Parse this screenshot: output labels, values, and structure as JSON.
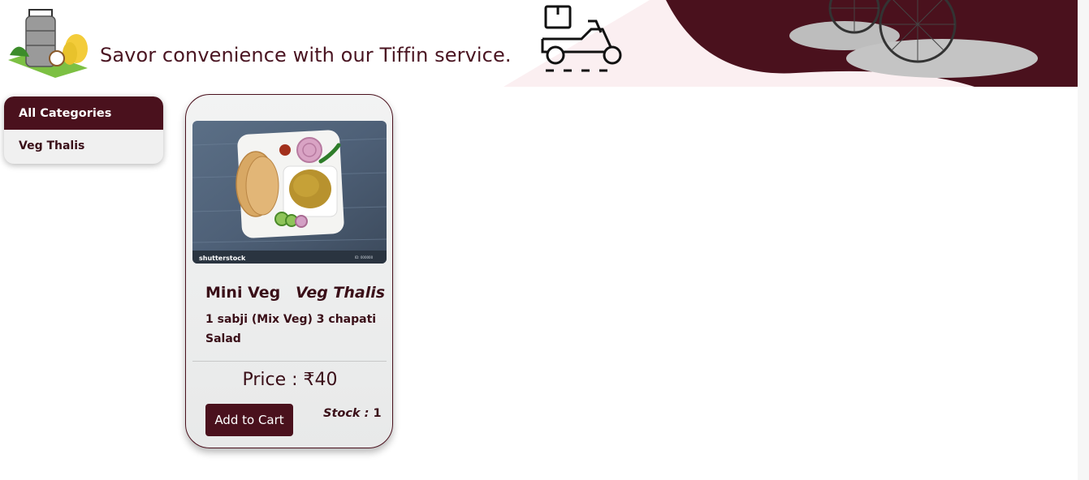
{
  "banner": {
    "tagline": "Savor convenience with our Tiffin service."
  },
  "sidebar": {
    "header": "All Categories",
    "items": [
      {
        "label": "Veg Thalis"
      }
    ]
  },
  "products": [
    {
      "name": "Mini Veg",
      "category": "Veg Thalis",
      "description": "1 sabji (Mix Veg) 3 chapati Salad",
      "price": "Price : ₹40",
      "add_to_cart_label": "Add to Cart",
      "stock_label": "Stock :",
      "stock_value": "1",
      "image_watermark": "shutterstock"
    }
  ],
  "colors": {
    "brand": "#4a111d",
    "text": "#3a0f18",
    "card_bg": "#f0f0f0"
  }
}
